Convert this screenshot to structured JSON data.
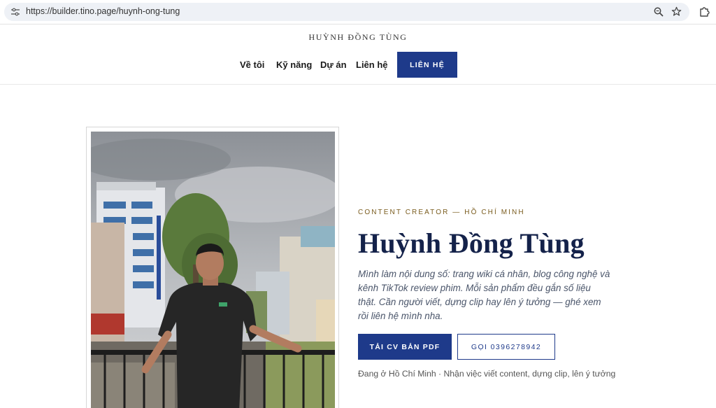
{
  "browser": {
    "url": "https://builder.tino.page/huynh-ong-tung",
    "icons": [
      "tune-icon",
      "zoom-icon",
      "star-icon",
      "extensions-icon"
    ]
  },
  "header": {
    "brand": "HUỲNH ĐỒNG TÙNG",
    "nav": {
      "about": "Về tôi",
      "skills": "Kỹ năng",
      "projects": "Dự án",
      "contact": "Liên hệ",
      "cta": "LIÊN HỆ"
    }
  },
  "hero": {
    "eyebrow": "CONTENT CREATOR — HỒ CHÍ MINH",
    "title": "Huỳnh Đồng Tùng",
    "description": "Mình làm nội dung số: trang wiki cá nhân, blog công nghệ và kênh TikTok review phim. Mỗi sản phẩm đều gắn số liệu thật. Cần người viết, dựng clip hay lên ý tưởng — ghé xem rồi liên hệ mình nha.",
    "primary_button": "TẢI CV BẢN PDF",
    "secondary_button": "GỌI 0396278942",
    "location_note": "Đang ở Hồ Chí Minh · Nhận việc viết content, dựng clip, lên ý tưởng"
  },
  "colors": {
    "primary": "#1e3a8a",
    "title": "#14224a",
    "eyebrow": "#7a5c1e"
  }
}
